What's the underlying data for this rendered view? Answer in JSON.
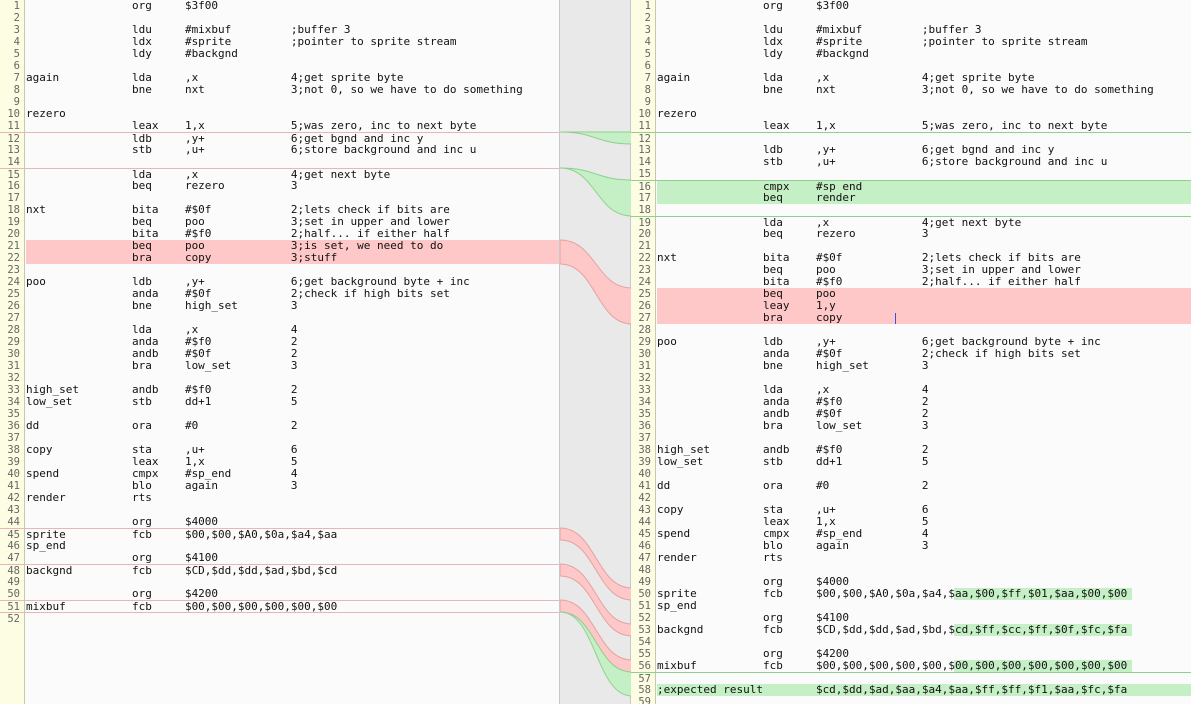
{
  "left": {
    "lines": [
      {
        "n": "1",
        "t": "                org     $3f00"
      },
      {
        "n": "2",
        "t": ""
      },
      {
        "n": "3",
        "t": "                ldu     #mixbuf         ;buffer 3"
      },
      {
        "n": "4",
        "t": "                ldx     #sprite         ;pointer to sprite stream"
      },
      {
        "n": "5",
        "t": "                ldy     #backgnd"
      },
      {
        "n": "6",
        "t": ""
      },
      {
        "n": "7",
        "t": "again           lda     ,x              4;get sprite byte"
      },
      {
        "n": "8",
        "t": "                bne     nxt             3;not 0, so we have to do something"
      },
      {
        "n": "9",
        "t": ""
      },
      {
        "n": "10",
        "t": "rezero"
      },
      {
        "n": "11",
        "t": "                leax    1,x             5;was zero, inc to next byte"
      },
      {
        "n": "12",
        "t": "                ldb     ,y+             6;get bgnd and inc y"
      },
      {
        "n": "13",
        "t": "                stb     ,u+             6;store background and inc u"
      },
      {
        "n": "14",
        "t": ""
      },
      {
        "n": "15",
        "t": "                lda     ,x              4;get next byte"
      },
      {
        "n": "16",
        "t": "                beq     rezero          3"
      },
      {
        "n": "17",
        "t": ""
      },
      {
        "n": "18",
        "t": "nxt             bita    #$0f            2;lets check if bits are"
      },
      {
        "n": "19",
        "t": "                beq     poo             3;set in upper and lower"
      },
      {
        "n": "20",
        "t": "                bita    #$f0            2;half... if either half"
      },
      {
        "n": "21",
        "t": "                beq     poo             3;is set, we need to do"
      },
      {
        "n": "22",
        "t": "                bra     copy            3;stuff"
      },
      {
        "n": "23",
        "t": ""
      },
      {
        "n": "24",
        "t": "poo             ldb     ,y+             6;get background byte + inc"
      },
      {
        "n": "25",
        "t": "                anda    #$0f            2;check if high bits set"
      },
      {
        "n": "26",
        "t": "                bne     high_set        3"
      },
      {
        "n": "27",
        "t": ""
      },
      {
        "n": "28",
        "t": "                lda     ,x              4"
      },
      {
        "n": "29",
        "t": "                anda    #$f0            2"
      },
      {
        "n": "30",
        "t": "                andb    #$0f            2"
      },
      {
        "n": "31",
        "t": "                bra     low_set         3"
      },
      {
        "n": "32",
        "t": ""
      },
      {
        "n": "33",
        "t": "high_set        andb    #$f0            2"
      },
      {
        "n": "34",
        "t": "low_set         stb     dd+1            5"
      },
      {
        "n": "35",
        "t": ""
      },
      {
        "n": "36",
        "t": "dd              ora     #0              2"
      },
      {
        "n": "37",
        "t": ""
      },
      {
        "n": "38",
        "t": "copy            sta     ,u+             6"
      },
      {
        "n": "39",
        "t": "                leax    1,x             5"
      },
      {
        "n": "40",
        "t": "spend           cmpx    #sp_end         4"
      },
      {
        "n": "41",
        "t": "                blo     again           3"
      },
      {
        "n": "42",
        "t": "render          rts"
      },
      {
        "n": "43",
        "t": ""
      },
      {
        "n": "44",
        "t": "                org     $4000"
      },
      {
        "n": "45",
        "t": "sprite          fcb     $00,$00,$A0,$0a,$a4,$aa"
      },
      {
        "n": "46",
        "t": "sp_end"
      },
      {
        "n": "47",
        "t": "                org     $4100"
      },
      {
        "n": "48",
        "t": "backgnd         fcb     $CD,$dd,$dd,$ad,$bd,$cd"
      },
      {
        "n": "49",
        "t": ""
      },
      {
        "n": "50",
        "t": "                org     $4200"
      },
      {
        "n": "51",
        "t": "mixbuf          fcb     $00,$00,$00,$00,$00,$00"
      },
      {
        "n": "52",
        "t": ""
      }
    ]
  },
  "right": {
    "lines": [
      {
        "n": "1",
        "t": "                org     $3f00"
      },
      {
        "n": "2",
        "t": ""
      },
      {
        "n": "3",
        "t": "                ldu     #mixbuf         ;buffer 3"
      },
      {
        "n": "4",
        "t": "                ldx     #sprite         ;pointer to sprite stream"
      },
      {
        "n": "5",
        "t": "                ldy     #backgnd"
      },
      {
        "n": "6",
        "t": ""
      },
      {
        "n": "7",
        "t": "again           lda     ,x              4;get sprite byte"
      },
      {
        "n": "8",
        "t": "                bne     nxt             3;not 0, so we have to do something"
      },
      {
        "n": "9",
        "t": ""
      },
      {
        "n": "10",
        "t": "rezero"
      },
      {
        "n": "11",
        "t": "                leax    1,x             5;was zero, inc to next byte"
      },
      {
        "n": "12",
        "t": ""
      },
      {
        "n": "13",
        "t": "                ldb     ,y+             6;get bgnd and inc y"
      },
      {
        "n": "14",
        "t": "                stb     ,u+             6;store background and inc u"
      },
      {
        "n": "15",
        "t": ""
      },
      {
        "n": "16",
        "t": "                cmpx    #sp_end"
      },
      {
        "n": "17",
        "t": "                beq     render"
      },
      {
        "n": "18",
        "t": ""
      },
      {
        "n": "19",
        "t": "                lda     ,x              4;get next byte"
      },
      {
        "n": "20",
        "t": "                beq     rezero          3"
      },
      {
        "n": "21",
        "t": ""
      },
      {
        "n": "22",
        "t": "nxt             bita    #$0f            2;lets check if bits are"
      },
      {
        "n": "23",
        "t": "                beq     poo             3;set in upper and lower"
      },
      {
        "n": "24",
        "t": "                bita    #$f0            2;half... if either half"
      },
      {
        "n": "25",
        "t": "                beq     poo"
      },
      {
        "n": "26",
        "t": "                leay    1,y"
      },
      {
        "n": "27",
        "t": "                bra     copy"
      },
      {
        "n": "28",
        "t": ""
      },
      {
        "n": "29",
        "t": "poo             ldb     ,y+             6;get background byte + inc"
      },
      {
        "n": "30",
        "t": "                anda    #$0f            2;check if high bits set"
      },
      {
        "n": "31",
        "t": "                bne     high_set        3"
      },
      {
        "n": "32",
        "t": ""
      },
      {
        "n": "33",
        "t": "                lda     ,x              4"
      },
      {
        "n": "34",
        "t": "                anda    #$f0            2"
      },
      {
        "n": "35",
        "t": "                andb    #$0f            2"
      },
      {
        "n": "36",
        "t": "                bra     low_set         3"
      },
      {
        "n": "37",
        "t": ""
      },
      {
        "n": "38",
        "t": "high_set        andb    #$f0            2"
      },
      {
        "n": "39",
        "t": "low_set         stb     dd+1            5"
      },
      {
        "n": "40",
        "t": ""
      },
      {
        "n": "41",
        "t": "dd              ora     #0              2"
      },
      {
        "n": "42",
        "t": ""
      },
      {
        "n": "43",
        "t": "copy            sta     ,u+             6"
      },
      {
        "n": "44",
        "t": "                leax    1,x             5"
      },
      {
        "n": "45",
        "t": "spend           cmpx    #sp_end         4"
      },
      {
        "n": "46",
        "t": "                blo     again           3"
      },
      {
        "n": "47",
        "t": "render          rts"
      },
      {
        "n": "48",
        "t": ""
      },
      {
        "n": "49",
        "t": "                org     $4000"
      },
      {
        "n": "50",
        "t": "sprite          fcb     $00,$00,$A0,$0a,$a4,$aa,$00,$ff,$01,$aa,$00,$00"
      },
      {
        "n": "51",
        "t": "sp_end"
      },
      {
        "n": "52",
        "t": "                org     $4100"
      },
      {
        "n": "53",
        "t": "backgnd         fcb     $CD,$dd,$dd,$ad,$bd,$cd,$ff,$cc,$ff,$0f,$fc,$fa"
      },
      {
        "n": "54",
        "t": ""
      },
      {
        "n": "55",
        "t": "                org     $4200"
      },
      {
        "n": "56",
        "t": "mixbuf          fcb     $00,$00,$00,$00,$00,$00,$00,$00,$00,$00,$00,$00"
      },
      {
        "n": "57",
        "t": ""
      },
      {
        "n": "58",
        "t": ";expected result        $cd,$dd,$ad,$aa,$a4,$aa,$ff,$ff,$f1,$aa,$fc,$fa"
      },
      {
        "n": "59",
        "t": ""
      }
    ]
  },
  "colors": {
    "deleted": "#ffc8c8",
    "added": "#c5efc5",
    "changed_inline": "#c8c8ff",
    "gutter": "#fdfde3"
  }
}
